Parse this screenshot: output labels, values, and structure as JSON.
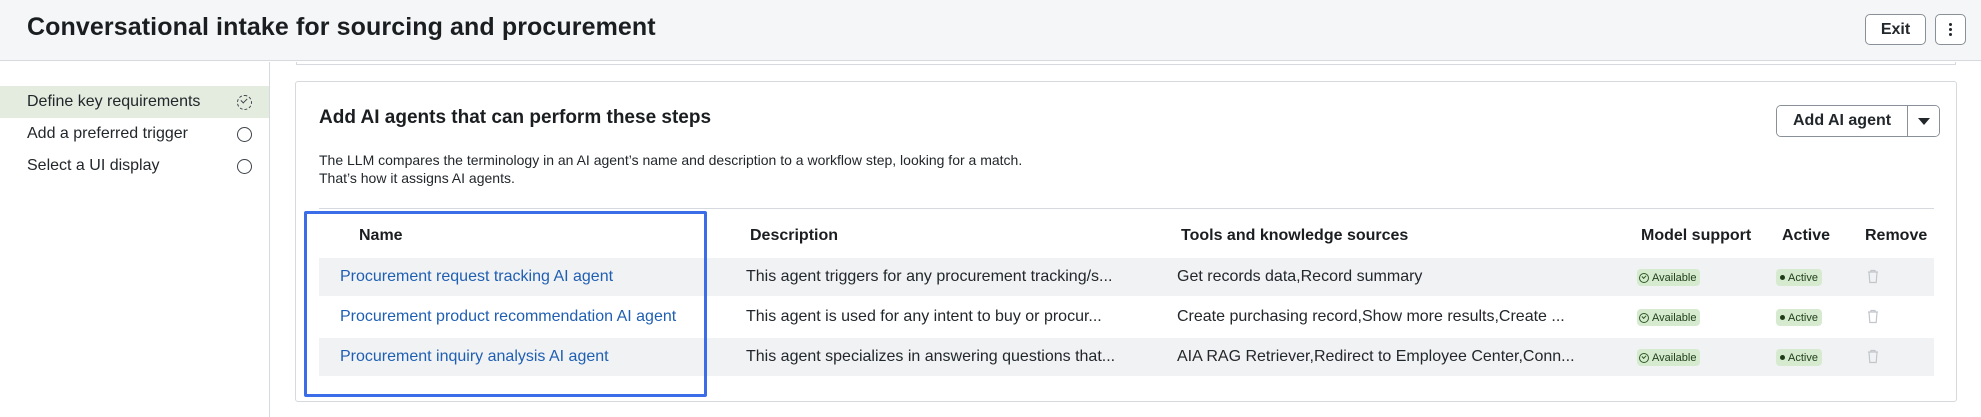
{
  "header": {
    "title": "Conversational intake for sourcing and procurement",
    "exit_label": "Exit",
    "more_icon": "more-vertical-icon"
  },
  "sidebar": {
    "items": [
      {
        "label": "Define key requirements",
        "state": "in-progress",
        "active": true
      },
      {
        "label": "Add a preferred trigger",
        "state": "not-started",
        "active": false
      },
      {
        "label": "Select a UI display",
        "state": "not-started",
        "active": false
      }
    ]
  },
  "card": {
    "title": "Add AI agents that can perform these steps",
    "description_line1": "The LLM compares the terminology in an AI agent’s name and description to a workflow step, looking for a match.",
    "description_line2": "That’s how it assigns AI agents.",
    "add_button_label": "Add AI agent"
  },
  "table": {
    "columns": [
      "Name",
      "Description",
      "Tools and knowledge sources",
      "Model support",
      "Active",
      "Remove"
    ],
    "rows": [
      {
        "name": "Procurement request tracking AI agent",
        "description": "This agent triggers for any procurement tracking/s...",
        "tools": "Get records data,Record summary",
        "model_support": "Available",
        "active": "Active"
      },
      {
        "name": "Procurement product recommendation AI agent",
        "description": "This agent is used for any intent to buy or procur...",
        "tools": "Create purchasing record,Show more results,Create ...",
        "model_support": "Available",
        "active": "Active"
      },
      {
        "name": "Procurement inquiry analysis AI agent",
        "description": "This agent specializes in answering questions that...",
        "tools": "AIA RAG Retriever,Redirect to Employee Center,Conn...",
        "model_support": "Available",
        "active": "Active"
      }
    ]
  },
  "colors": {
    "link": "#1f5fb3",
    "highlight": "#3b6de8",
    "badge_bg": "#d6ead0",
    "sidebar_active": "#e3ecdf"
  }
}
